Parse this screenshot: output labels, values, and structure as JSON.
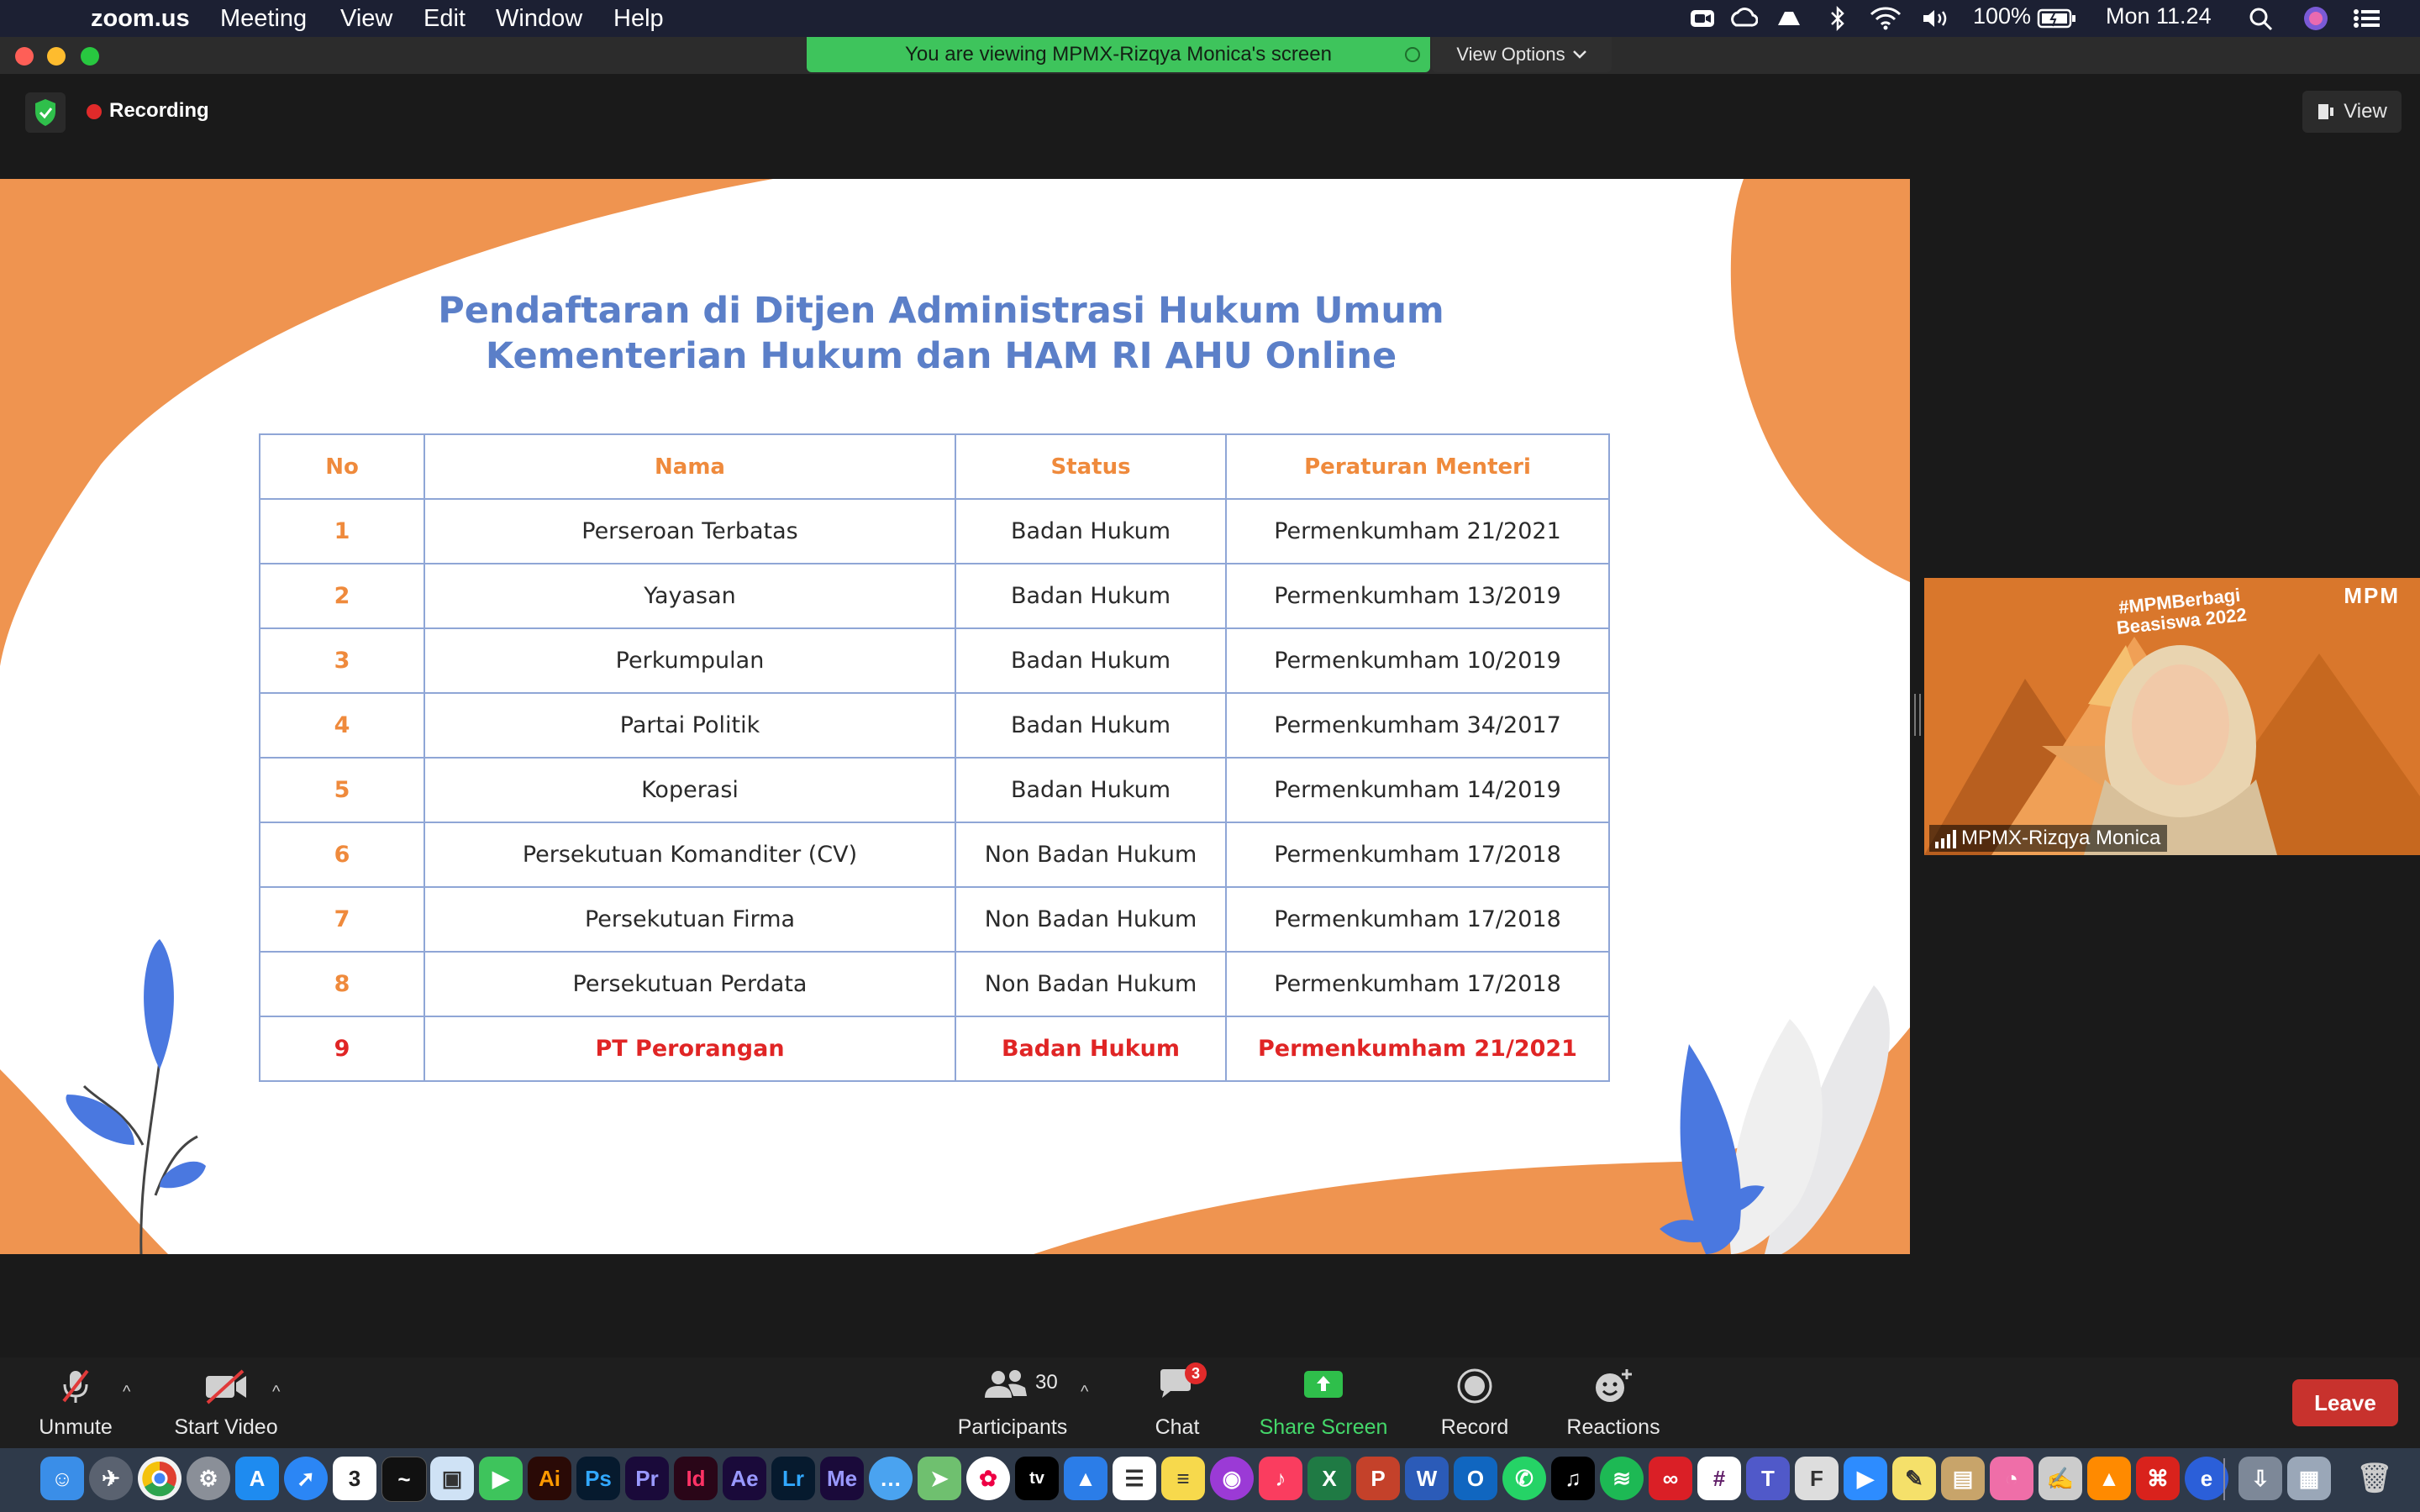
{
  "menubar": {
    "app": "zoom.us",
    "items": [
      "Meeting",
      "View",
      "Edit",
      "Window",
      "Help"
    ],
    "battery": "100%",
    "clock": "Mon 11.24"
  },
  "banner": {
    "viewing_text": "You are viewing MPMX-Rizqya Monica's screen",
    "view_options": "View Options"
  },
  "header": {
    "recording": "Recording",
    "view_button": "View"
  },
  "slide": {
    "title_line1": "Pendaftaran di Ditjen Administrasi Hukum Umum",
    "title_line2": "Kementerian Hukum dan HAM RI AHU Online",
    "table": {
      "headers": [
        "No",
        "Nama",
        "Status",
        "Peraturan Menteri"
      ],
      "rows": [
        [
          "1",
          "Perseroan Terbatas",
          "Badan Hukum",
          "Permenkumham 21/2021"
        ],
        [
          "2",
          "Yayasan",
          "Badan Hukum",
          "Permenkumham 13/2019"
        ],
        [
          "3",
          "Perkumpulan",
          "Badan Hukum",
          "Permenkumham 10/2019"
        ],
        [
          "4",
          "Partai Politik",
          "Badan Hukum",
          "Permenkumham 34/2017"
        ],
        [
          "5",
          "Koperasi",
          "Badan Hukum",
          "Permenkumham 14/2019"
        ],
        [
          "6",
          "Persekutuan Komanditer (CV)",
          "Non Badan Hukum",
          "Permenkumham 17/2018"
        ],
        [
          "7",
          "Persekutuan Firma",
          "Non Badan Hukum",
          "Permenkumham 17/2018"
        ],
        [
          "8",
          "Persekutuan Perdata",
          "Non Badan Hukum",
          "Permenkumham 17/2018"
        ],
        [
          "9",
          "PT Perorangan",
          "Badan Hukum",
          "Permenkumham 21/2021"
        ]
      ]
    },
    "colors": {
      "orange": "#ef8a3c",
      "blue": "#5b7fc8",
      "highlight_red": "#e02525"
    }
  },
  "video": {
    "participant_name": "MPMX-Rizqya Monica",
    "tag_banner": "#MPMBerbagi Beasiswa 2022",
    "logo": "MPM"
  },
  "toolbar": {
    "unmute": "Unmute",
    "start_video": "Start Video",
    "participants": "Participants",
    "participants_count": "30",
    "chat": "Chat",
    "chat_badge": "3",
    "share_screen": "Share Screen",
    "record": "Record",
    "reactions": "Reactions",
    "leave": "Leave"
  },
  "dock": {
    "labeled_icons": [
      "Ai",
      "Ps",
      "Pr",
      "Id",
      "Ae",
      "Lr",
      "Me"
    ],
    "calendar_day": "3"
  }
}
